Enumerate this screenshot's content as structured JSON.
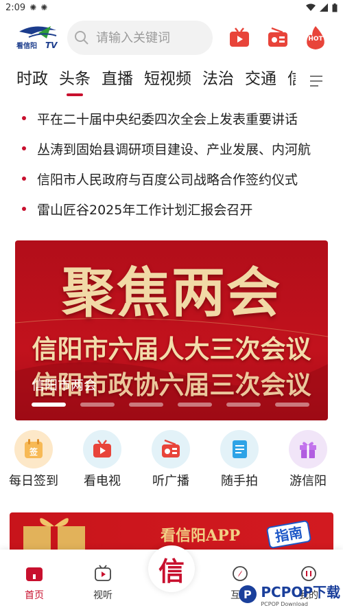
{
  "status_bar": {
    "time": "2:09",
    "icons": [
      "burst-icon",
      "burst-icon"
    ]
  },
  "header": {
    "logo_text": "看信阳TV",
    "search_placeholder": "请输入关键词",
    "icons": [
      "tv-play-icon",
      "radio-icon",
      "hot-icon"
    ],
    "hot_label": "HOT"
  },
  "tabs": {
    "items": [
      "时政",
      "头条",
      "直播",
      "短视频",
      "法治",
      "交通",
      "信"
    ],
    "active_index": 1
  },
  "news": [
    "平在二十届中央纪委四次全会上发表重要讲话",
    "丛涛到固始县调研项目建设、产业发展、内河航",
    "信阳市人民政府与百度公司战略合作签约仪式",
    "雷山匠谷2025年工作计划汇报会召开"
  ],
  "banner": {
    "art_title": "聚焦两会",
    "line1": "信阳市六届人大三次会议",
    "line2": "信阳市政协六届三次会议",
    "caption": "信阳市两会",
    "slide_count": 6,
    "active_slide": 0
  },
  "quick_entries": [
    {
      "label": "每日签到",
      "icon": "sign-in-calendar-icon",
      "icon_glyph": "签",
      "color": "#f5a623"
    },
    {
      "label": "看电视",
      "icon": "tv-icon",
      "color": "#e8443a"
    },
    {
      "label": "听广播",
      "icon": "radio-icon",
      "color": "#e8443a"
    },
    {
      "label": "随手拍",
      "icon": "notebook-icon",
      "color": "#2ea3e6"
    },
    {
      "label": "游信阳",
      "icon": "gift-icon",
      "color": "#b15ee0"
    }
  ],
  "promo": {
    "text": "看信阳APP",
    "badge": "指南"
  },
  "bottom_nav": {
    "items": [
      "首页",
      "视听",
      "",
      "互动",
      "我的"
    ],
    "active_index": 0,
    "center_glyph": "信"
  },
  "watermark": {
    "text": "PCPOP下载",
    "subtext": "PCPOP Download"
  },
  "colors": {
    "accent": "#c8102e",
    "banner_red": "#b20e1a",
    "gold": "#f1d9a6"
  }
}
